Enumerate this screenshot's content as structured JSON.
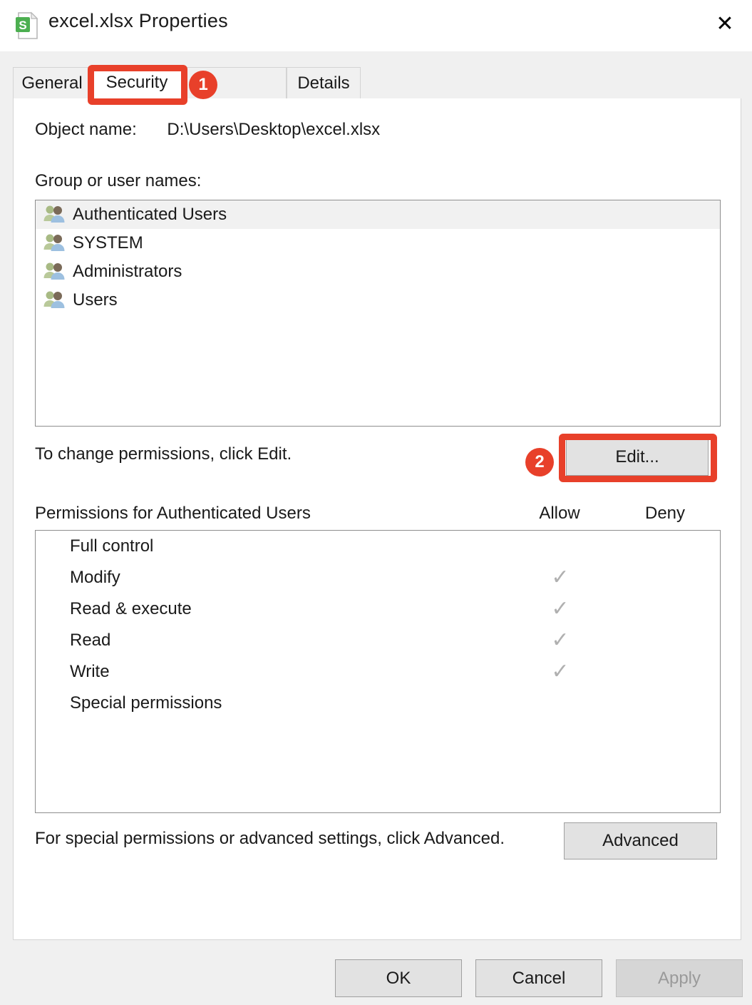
{
  "window": {
    "title": "excel.xlsx Properties",
    "icon": "spreadsheet-file-icon",
    "close_label": "✕"
  },
  "tabs": [
    {
      "label": "General",
      "selected": false
    },
    {
      "label": "Security",
      "selected": true
    },
    {
      "label": "",
      "selected": false
    },
    {
      "label": "Details",
      "selected": false
    }
  ],
  "security": {
    "object_name_label": "Object name:",
    "object_name_value": "D:\\Users\\Desktop\\excel.xlsx",
    "group_list_label": "Group or user names:",
    "group_users": [
      {
        "name": "Authenticated Users",
        "selected": true
      },
      {
        "name": "SYSTEM",
        "selected": false
      },
      {
        "name": "Administrators",
        "selected": false
      },
      {
        "name": "Users",
        "selected": false
      }
    ],
    "edit_hint": "To change permissions, click Edit.",
    "edit_button": "Edit...",
    "permissions_header": "Permissions for Authenticated Users",
    "column_allow": "Allow",
    "column_deny": "Deny",
    "permissions": [
      {
        "name": "Full control",
        "allow": "",
        "deny": ""
      },
      {
        "name": "Modify",
        "allow": "✓",
        "deny": ""
      },
      {
        "name": "Read & execute",
        "allow": "✓",
        "deny": ""
      },
      {
        "name": "Read",
        "allow": "✓",
        "deny": ""
      },
      {
        "name": "Write",
        "allow": "✓",
        "deny": ""
      },
      {
        "name": "Special permissions",
        "allow": "",
        "deny": ""
      }
    ],
    "advanced_hint": "For special permissions or advanced settings, click Advanced.",
    "advanced_button": "Advanced"
  },
  "footer": {
    "ok": "OK",
    "cancel": "Cancel",
    "apply": "Apply",
    "apply_disabled": true
  },
  "annotations": [
    {
      "badge": "1",
      "target": "security-tab"
    },
    {
      "badge": "2",
      "target": "edit-button"
    }
  ],
  "colors": {
    "annotation": "#e8402a",
    "dialog_bg": "#f0f0f0",
    "content_bg": "#ffffff",
    "checkmark": "#b0b0b0"
  }
}
